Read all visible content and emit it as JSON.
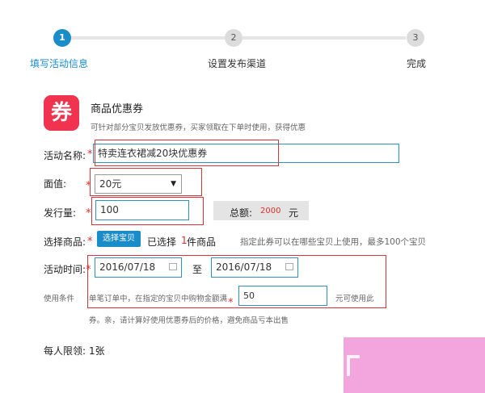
{
  "steps": [
    {
      "number": "1",
      "label": "填写活动信息"
    },
    {
      "number": "2",
      "label": "设置发布渠道"
    },
    {
      "number": "3",
      "label": "完成"
    }
  ],
  "coupon": {
    "icon_char": "券",
    "title": "商品优惠券",
    "description": "可针对部分宝贝发放优惠券，买家领取在下单时使用，获得优惠"
  },
  "form": {
    "activity_name_label": "活动名称:",
    "activity_name_value": "特卖连衣裙减20块优惠券",
    "face_value_label": "面值:",
    "face_value_selected": "20元",
    "issue_qty_label": "发行量:",
    "issue_qty_value": "100",
    "total_label": "总额:",
    "total_value": "2000",
    "total_unit": "元",
    "select_goods_label": "选择商品:",
    "select_goods_button": "选择宝贝",
    "selected_prefix": "已选择",
    "selected_count": "1",
    "selected_suffix": "件商品",
    "select_hint": "指定此券可以在哪些宝贝上使用，最多100个宝贝",
    "activity_time_label": "活动时间:",
    "start_date": "2016/07/18",
    "to_label": "至",
    "end_date": "2016/07/18",
    "usage_label": "使用条件",
    "usage_text": "单笔订单中，在指定的宝贝中购物金额满",
    "usage_amount": "50",
    "usage_suffix": "元可使用此",
    "usage_note": "券。亲，请计算好使用优惠券后的价格，避免商品亏本出售",
    "limit_label": "每人限领:",
    "limit_value": "1张"
  },
  "colors": {
    "accent": "#1a8cc8",
    "badge": "#f0344f",
    "required_star": "#e0302b",
    "highlight_box": "#d9333a",
    "watermark": "#f3a6dd"
  }
}
